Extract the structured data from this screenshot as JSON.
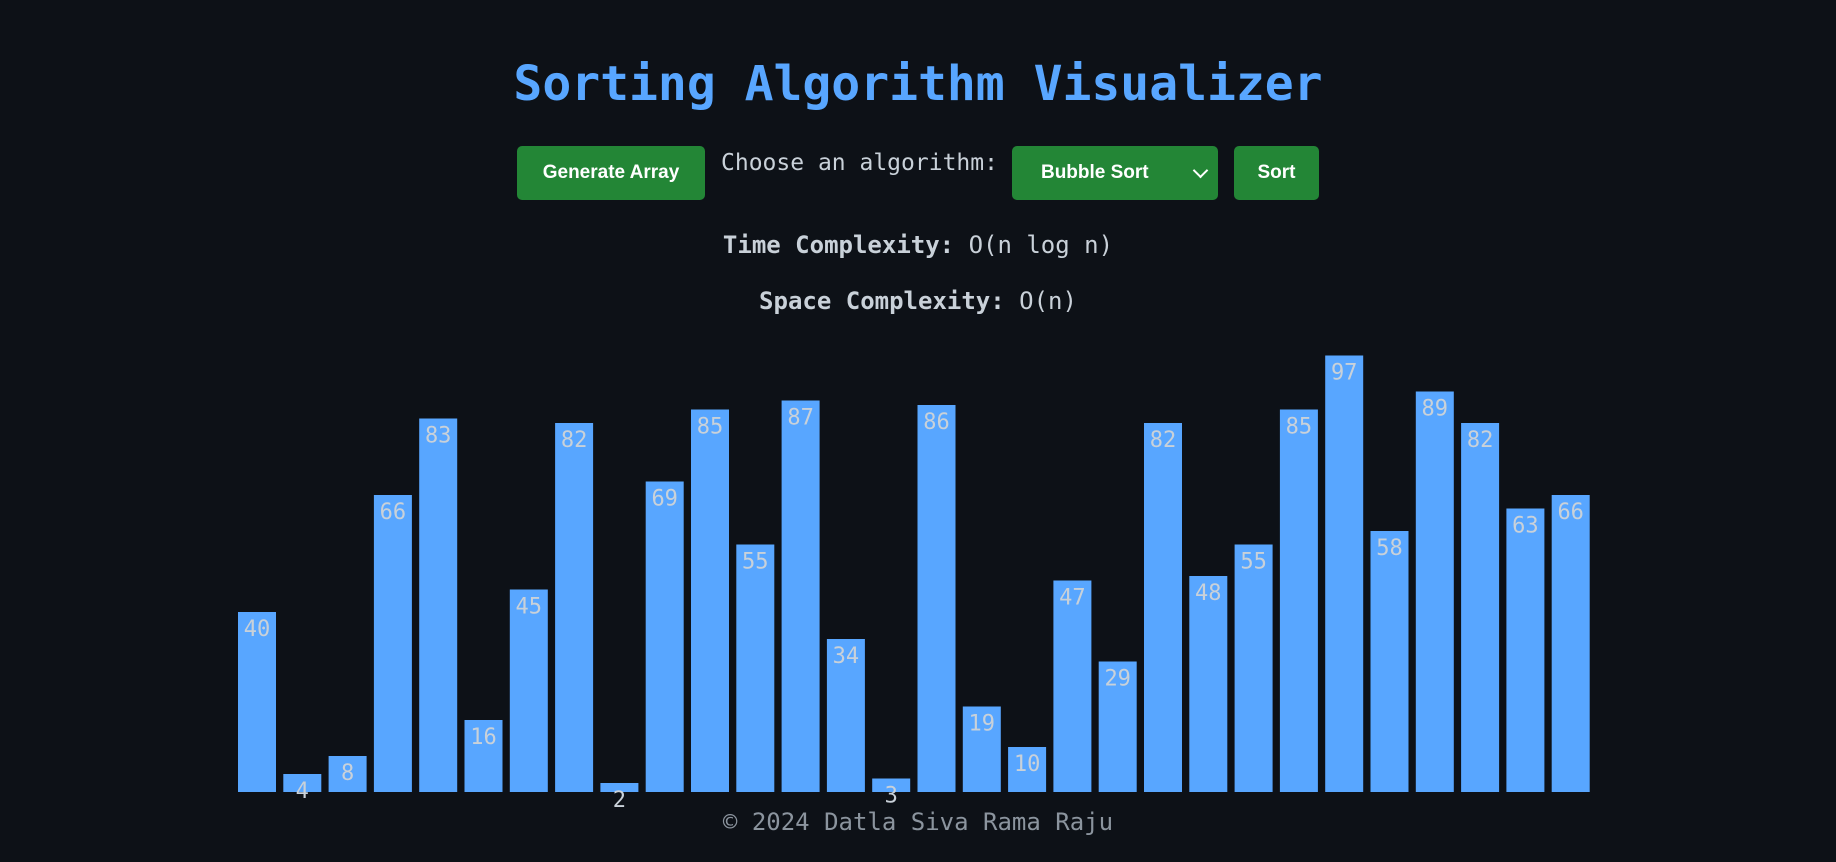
{
  "title": "Sorting Algorithm Visualizer",
  "controls": {
    "generate_label": "Generate Array",
    "choose_label": "Choose an algorithm:",
    "algorithm_selected": "Bubble Sort",
    "sort_label": "Sort"
  },
  "complexity": {
    "time_label": "Time Complexity:",
    "time_value": "O(n log n)",
    "space_label": "Space Complexity:",
    "space_value": "O(n)"
  },
  "colors": {
    "accent": "#58a6ff",
    "button": "#238636",
    "background": "#0d1117"
  },
  "icons": {
    "select": "chevron-down-icon"
  },
  "array": [
    40,
    4,
    8,
    66,
    83,
    16,
    45,
    82,
    2,
    69,
    85,
    55,
    87,
    34,
    3,
    86,
    19,
    10,
    47,
    29,
    82,
    48,
    55,
    85,
    97,
    58,
    89,
    82,
    63,
    66
  ],
  "footer": "© 2024 Datla Siva Rama Raju"
}
